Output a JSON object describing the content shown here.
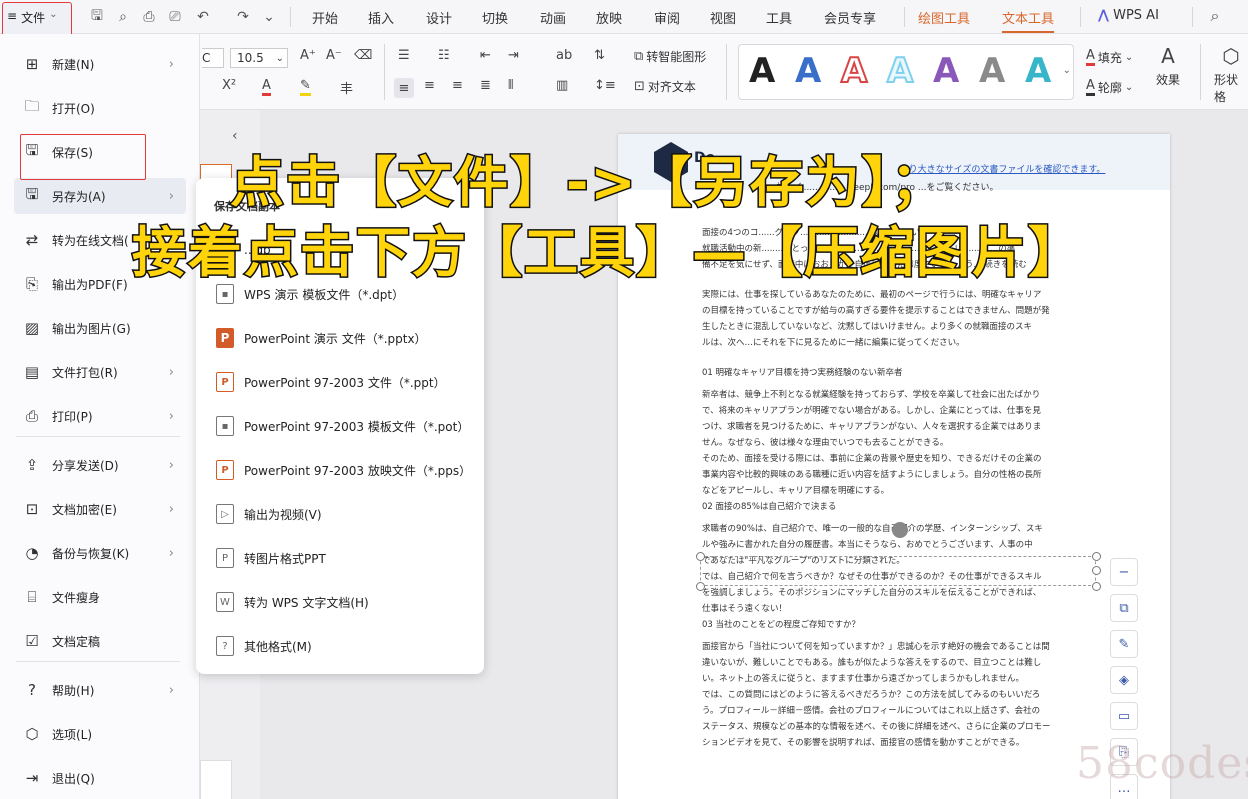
{
  "topbar": {
    "file_icon": "≡",
    "file_label": "文件",
    "file_caret": "⌄",
    "tabs": [
      "开始",
      "插入",
      "设计",
      "切换",
      "动画",
      "放映",
      "审阅",
      "视图",
      "工具",
      "会员专享",
      "绘图工具",
      "文本工具",
      "WPS AI"
    ]
  },
  "ribbon": {
    "font_size": "10.5",
    "font_partial": "C",
    "smart_graphic": "转智能图形",
    "align_text": "对齐文本",
    "fill_label": "填充",
    "outline_label": "轮廓",
    "effect_label": "效果",
    "shape_partial": "形状格",
    "style_letters": [
      "A",
      "A",
      "A",
      "A",
      "A",
      "A",
      "A"
    ],
    "style_colors": [
      "#111111",
      "#3a6fc9",
      "#d94545",
      "#7fd0ef",
      "#8a58b8",
      "#8a8a8a",
      "#38b6c9"
    ],
    "superscript": "X²"
  },
  "file_menu": {
    "items": [
      {
        "label": "新建(N)",
        "icon": "new-doc-icon",
        "glyph": "⊞",
        "has_sub": true
      },
      {
        "label": "打开(O)",
        "icon": "folder-icon",
        "glyph": "🗀",
        "has_sub": false
      },
      {
        "label": "保存(S)",
        "icon": "save-icon",
        "glyph": "🖫",
        "has_sub": false
      },
      {
        "label": "另存为(A)",
        "icon": "save-as-icon",
        "glyph": "🖫",
        "has_sub": true
      },
      {
        "label": "转为在线文档(",
        "icon": "online-doc-icon",
        "glyph": "⇄",
        "has_sub": false
      },
      {
        "label": "输出为PDF(F)",
        "icon": "pdf-icon",
        "glyph": "⎘",
        "has_sub": false
      },
      {
        "label": "输出为图片(G)",
        "icon": "image-icon",
        "glyph": "▨",
        "has_sub": false
      },
      {
        "label": "文件打包(R)",
        "icon": "package-icon",
        "glyph": "▤",
        "has_sub": true
      },
      {
        "label": "打印(P)",
        "icon": "print-icon",
        "glyph": "⎙",
        "has_sub": true
      },
      {
        "label": "分享发送(D)",
        "icon": "share-icon",
        "glyph": "⇪",
        "has_sub": true
      },
      {
        "label": "文档加密(E)",
        "icon": "lock-icon",
        "glyph": "⊡",
        "has_sub": true
      },
      {
        "label": "备份与恢复(K)",
        "icon": "backup-icon",
        "glyph": "◔",
        "has_sub": true
      },
      {
        "label": "文件瘦身",
        "icon": "slim-icon",
        "glyph": "⌸",
        "has_sub": false
      },
      {
        "label": "文档定稿",
        "icon": "finalize-icon",
        "glyph": "☑",
        "has_sub": false
      },
      {
        "label": "帮助(H)",
        "icon": "help-icon",
        "glyph": "?",
        "has_sub": true
      },
      {
        "label": "选项(L)",
        "icon": "options-icon",
        "glyph": "⬡",
        "has_sub": false
      },
      {
        "label": "退出(Q)",
        "icon": "exit-icon",
        "glyph": "⇥",
        "has_sub": false
      }
    ]
  },
  "submenu": {
    "title": "保存文档副本",
    "items": [
      {
        "label": "...dp",
        "kind": "dpt-partial"
      },
      {
        "label": "WPS 演示 模板文件（*.dpt）",
        "kind": "dpt"
      },
      {
        "label": "PowerPoint 演示 文件（*.pptx）",
        "kind": "pptx"
      },
      {
        "label": "PowerPoint 97-2003 文件（*.ppt）",
        "kind": "ppt"
      },
      {
        "label": "PowerPoint 97-2003 模板文件（*.pot）",
        "kind": "pot"
      },
      {
        "label": "PowerPoint 97-2003 放映文件（*.pps）",
        "kind": "pps"
      },
      {
        "label": "输出为视频(V)",
        "kind": "video"
      },
      {
        "label": "转图片格式PPT",
        "kind": "img-ppt"
      },
      {
        "label": "转为 WPS 文字文档(H)",
        "kind": "wps-doc"
      },
      {
        "label": "其他格式(M)",
        "kind": "other"
      }
    ]
  },
  "document": {
    "header_link": "...り大きなサイズの文書ファイルを確認できます。",
    "header_line2": "...詳しく.............. DeepL.com/pro ...をご覧ください。",
    "lines": [
      "面接の4つのコ......グック..........................入....だ.....い",
      "就職活動中の新........にとっ.....................は..............................い.............の準",
      "備不足を気にせず、面接中はおおらかで自信に満ちた態度でいましょう... 続きを読む",
      "",
      "実際には、仕事を探しているあなたのために、最初のページで行うには、明確なキャリア",
      "の目標を持っていることですが給与の高すぎる要件を提示することはできません、問題が発",
      "生したときに混乱していないなど、沈黙してはいけません。より多くの就職面接のスキ",
      "ルは、次へ…にそれを下に見るために一緒に編集に従ってください。",
      "",
      "01 明確なキャリア目標を持つ実務経験のない新卒者",
      "新卒者は、競争上不利となる就業経験を持っておらず、学校を卒業して社会に出たばかり",
      "で、将来のキャリアプランが明確でない場合がある。しかし、企業にとっては、仕事を見",
      "つけ、求職者を見つけるために、キャリアプランがない、人々を選択する企業ではありま",
      "せん。なぜなら、彼は様々な理由でいつでも去ることができる。",
      "そのため、面接を受ける際には、事前に企業の背景や歴史を知り、できるだけその企業の",
      "事業内容や比較的興味のある職種に近い内容を話すようにしましょう。自分の性格の長所",
      "などをアピールし、キャリア目標を明確にする。",
      "02 面接の85%は自己紹介で決まる",
      "求職者の90%は、自己紹介で、唯一の一般的な自己紹介の学歴、インターンシップ、スキ",
      "ルや強みに書かれた自分の履歴書。本当にそうなら、おめでとうございます、人事の中",
      "であなたは\"平凡なグループ\"のリストに分類された。",
      "では、自己紹介で何を言うべきか？なぜその仕事ができるのか？その仕事ができるスキル",
      "を強調しましょう。そのポジションにマッチした自分のスキルを伝えることができれば、",
      "仕事はそう遠くない！",
      "03 当社のことをどの程度ご存知ですか？",
      "面接官から「当社について何を知っていますか？」忠誠心を示す絶好の機会であることは間",
      "違いないが、難しいことでもある。誰もが似たような答えをするので、目立つことは難し",
      "い。ネット上の答えに従うと、ますます仕事から遠ざかってしまうかもしれません。",
      "では、この質問にはどのように答えるべきだろうか？この方法を試してみるのもいいだろ",
      "う。プロフィール－詳細－感情。会社のプロフィールについてはこれ以上話さず、会社の",
      "ステータス、規模などの基本的な情報を述べ、その後に詳細を述べ、さらに企業のプロモー",
      "ションビデオを見て、その影響を説明すれば、面接官の感情を動かすことができる。"
    ],
    "logo_text": "De"
  },
  "caption": {
    "line1": "点击【文件】->【另存为】；",
    "line2": "接着点击下方【工具】—【压缩图片】"
  },
  "watermark": "58codes",
  "side_tools": [
    "−",
    "⧉",
    "✎",
    "◈",
    "▭",
    "⎘",
    "…"
  ]
}
